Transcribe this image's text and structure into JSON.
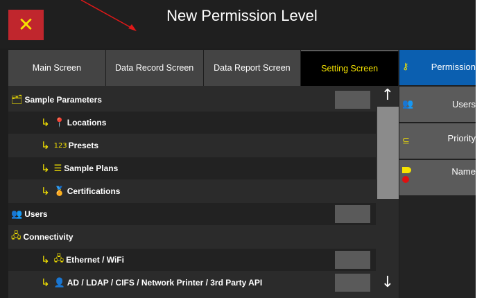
{
  "header": {
    "title": "New Permission Level",
    "close_label": "✕"
  },
  "tabs": [
    {
      "label": "Main Screen",
      "active": false
    },
    {
      "label": "Data Record Screen",
      "active": false
    },
    {
      "label": "Data Report Screen",
      "active": false
    },
    {
      "label": "Setting Screen",
      "active": true
    }
  ],
  "rows": [
    {
      "label": "Sample Parameters",
      "icon": "sample-params-icon",
      "glyph": "🗂",
      "child": false,
      "toggle": true
    },
    {
      "label": "Locations",
      "icon": "location-pin-icon",
      "glyph": "📍",
      "child": true,
      "toggle": false
    },
    {
      "label": "Presets",
      "icon": "presets-123-icon",
      "glyph": "123",
      "child": true,
      "toggle": false
    },
    {
      "label": "Sample Plans",
      "icon": "sample-plans-icon",
      "glyph": "☰",
      "child": true,
      "toggle": false
    },
    {
      "label": "Certifications",
      "icon": "certifications-icon",
      "glyph": "🏅",
      "child": true,
      "toggle": false
    },
    {
      "label": "Users",
      "icon": "users-icon",
      "glyph": "👥",
      "child": false,
      "toggle": true
    },
    {
      "label": "Connectivity",
      "icon": "network-icon",
      "glyph": "🖧",
      "child": false,
      "toggle": false
    },
    {
      "label": "Ethernet / WiFi",
      "icon": "network-icon",
      "glyph": "🖧",
      "child": true,
      "toggle": true
    },
    {
      "label": "AD / LDAP / CIFS / Network Printer / 3rd Party API",
      "icon": "user-network-icon",
      "glyph": "👤",
      "child": true,
      "toggle": true
    }
  ],
  "scroll": {
    "up_label": "↑",
    "down_label": "↓"
  },
  "sidebar": [
    {
      "label": "Permission",
      "icon": "key-user-icon",
      "active": true
    },
    {
      "label": "Users",
      "icon": "users-icon",
      "active": false
    },
    {
      "label": "Priority",
      "icon": "priority-icon",
      "active": false
    },
    {
      "label": "Name",
      "icon": "tag-icon",
      "active": false
    }
  ],
  "colors": {
    "accent": "#f6e400",
    "close": "#c0262d",
    "active_side": "#0b5fb0"
  }
}
